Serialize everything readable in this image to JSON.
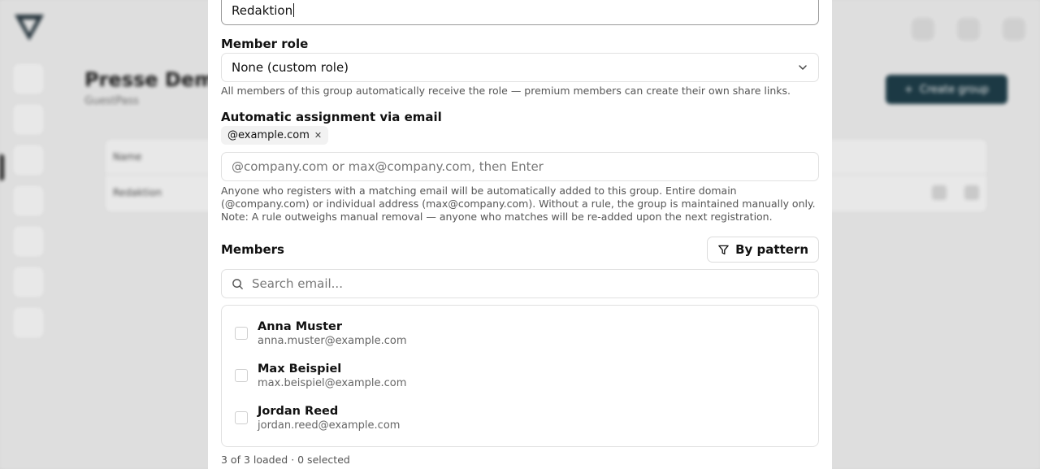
{
  "background": {
    "page_title": "Presse Demo",
    "page_subtitle": "GuestPass",
    "create_button_label": "Create group",
    "table_header_name": "Name",
    "table_row_name": "Redaktion"
  },
  "modal": {
    "group_name_value": "Redaktion",
    "member_role": {
      "label": "Member role",
      "selected": "None (custom role)",
      "help": "All members of this group automatically receive the role — premium members can create their own share links."
    },
    "auto_assign": {
      "label": "Automatic assignment via email",
      "chips": [
        "@example.com"
      ],
      "placeholder": "@company.com or max@company.com, then Enter",
      "help": "Anyone who registers with a matching email will be automatically added to this group. Entire domain (@company.com) or individual address (max@company.com). Without a rule, the group is maintained manually only. Note: A rule outweighs manual removal — anyone who matches will be re-added upon the next registration."
    },
    "members": {
      "label": "Members",
      "pattern_button": "By pattern",
      "search_placeholder": "Search email...",
      "items": [
        {
          "name": "Anna Muster",
          "email": "anna.muster@example.com"
        },
        {
          "name": "Max Beispiel",
          "email": "max.beispiel@example.com"
        },
        {
          "name": "Jordan Reed",
          "email": "jordan.reed@example.com"
        }
      ],
      "footer": "3 of 3 loaded · 0 selected"
    }
  }
}
